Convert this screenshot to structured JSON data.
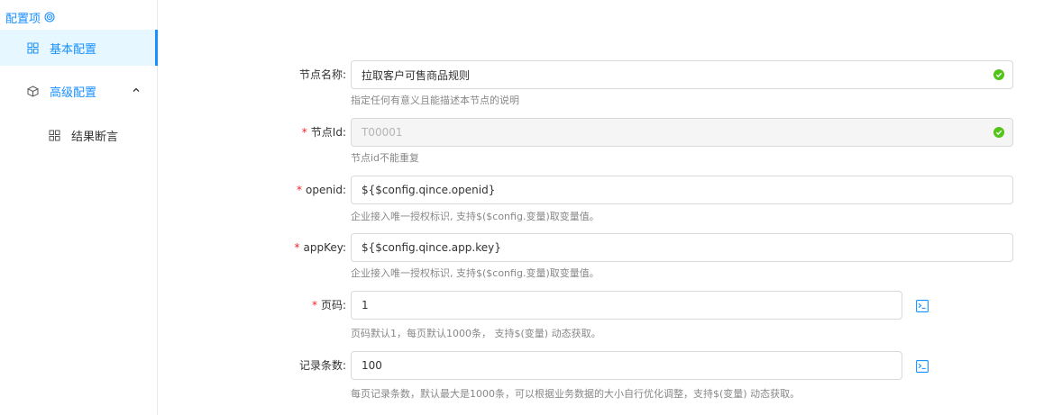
{
  "sidebar": {
    "title": "配置项",
    "items": [
      {
        "label": "基本配置",
        "icon": "grid-icon",
        "active": true
      },
      {
        "label": "高级配置",
        "icon": "cube-icon",
        "expanded": true
      },
      {
        "label": "结果断言",
        "icon": "grid-icon",
        "sub": true
      }
    ]
  },
  "form": {
    "fields": [
      {
        "label": "节点名称:",
        "required": false,
        "value": "拉取客户可售商品规则",
        "hint": "指定任何有意义且能描述本节点的说明",
        "valid": true
      },
      {
        "label": "节点Id:",
        "required": true,
        "value": "T00001",
        "disabled": true,
        "hint": "节点id不能重复",
        "valid": true
      },
      {
        "label": "openid:",
        "required": true,
        "value": "${$config.qince.openid}",
        "hint": "企业接入唯一授权标识, 支持$($config.变量)取变量值。"
      },
      {
        "label": "appKey:",
        "required": true,
        "value": "${$config.qince.app.key}",
        "hint": "企业接入唯一授权标识, 支持$($config.变量)取变量值。"
      },
      {
        "label": "页码:",
        "required": true,
        "value": "1",
        "hint": "页码默认1，每页默认1000条， 支持$(变量) 动态获取。"
      },
      {
        "label": "记录条数:",
        "required": false,
        "value": "100",
        "hint": "每页记录条数，默认最大是1000条，可以根据业务数据的大小自行优化调整，支持$(变量) 动态获取。"
      }
    ],
    "required_mark": "*"
  },
  "colors": {
    "accent": "#1890ff",
    "success": "#52c41a",
    "required": "#f5222d"
  }
}
